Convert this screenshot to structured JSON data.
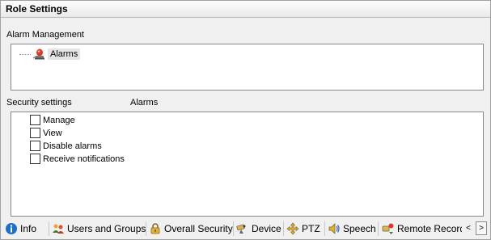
{
  "window": {
    "title": "Role Settings"
  },
  "alarm_management": {
    "label": "Alarm Management",
    "tree": [
      {
        "label": "Alarms",
        "icon": "alarm-siren-icon"
      }
    ]
  },
  "security": {
    "settings_label": "Security settings",
    "context_label": "Alarms",
    "items": [
      {
        "label": "Manage",
        "checked": false
      },
      {
        "label": "View",
        "checked": false
      },
      {
        "label": "Disable alarms",
        "checked": false
      },
      {
        "label": "Receive notifications",
        "checked": false
      }
    ]
  },
  "tabs": [
    {
      "label": "Info",
      "icon": "info-icon"
    },
    {
      "label": "Users and Groups",
      "icon": "users-groups-icon"
    },
    {
      "label": "Overall Security",
      "icon": "padlock-icon"
    },
    {
      "label": "Device",
      "icon": "camera-icon"
    },
    {
      "label": "PTZ",
      "icon": "ptz-arrows-icon"
    },
    {
      "label": "Speech",
      "icon": "speaker-icon"
    },
    {
      "label": "Remote Recordings",
      "icon": "remote-recording-icon"
    }
  ],
  "tab_scroll": {
    "left": "<",
    "right": ">"
  },
  "colors": {
    "selection": "#e5e5e5",
    "panel_border": "#828790",
    "info_blue": "#1e6fc9"
  }
}
